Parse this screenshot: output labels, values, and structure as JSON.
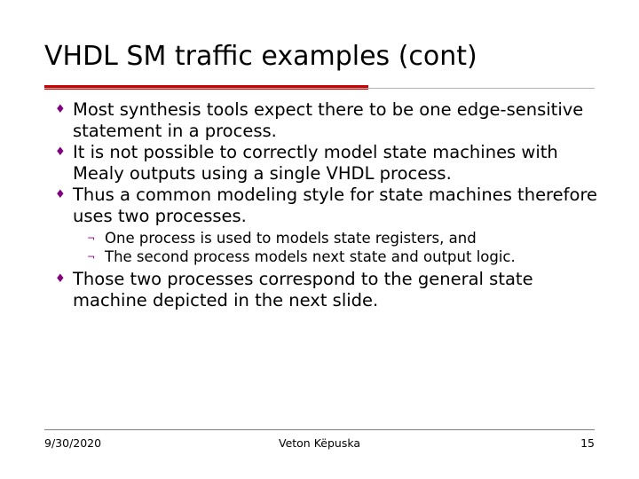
{
  "slide": {
    "title": "VHDL SM traffic examples (cont)",
    "accent_color": "#cc0000",
    "bullet_color": "#800080",
    "bullets": [
      {
        "level": 1,
        "marker": "♦",
        "text": "Most synthesis tools expect there to be one edge-sensitive statement in a process."
      },
      {
        "level": 1,
        "marker": "♦",
        "text": "It is not possible to correctly model state machines with Mealy outputs using a single VHDL process."
      },
      {
        "level": 1,
        "marker": "♦",
        "text": "Thus a common modeling style for state machines therefore uses two processes."
      },
      {
        "level": 2,
        "marker": "¬",
        "text": "One process is used to models state registers, and"
      },
      {
        "level": 2,
        "marker": "¬",
        "text": "The second process models next state and output logic."
      },
      {
        "level": 1,
        "marker": "♦",
        "text": "Those two processes correspond to the general state machine depicted in the next slide."
      }
    ],
    "footer": {
      "date": "9/30/2020",
      "author": "Veton Këpuska",
      "page_number": "15"
    }
  }
}
